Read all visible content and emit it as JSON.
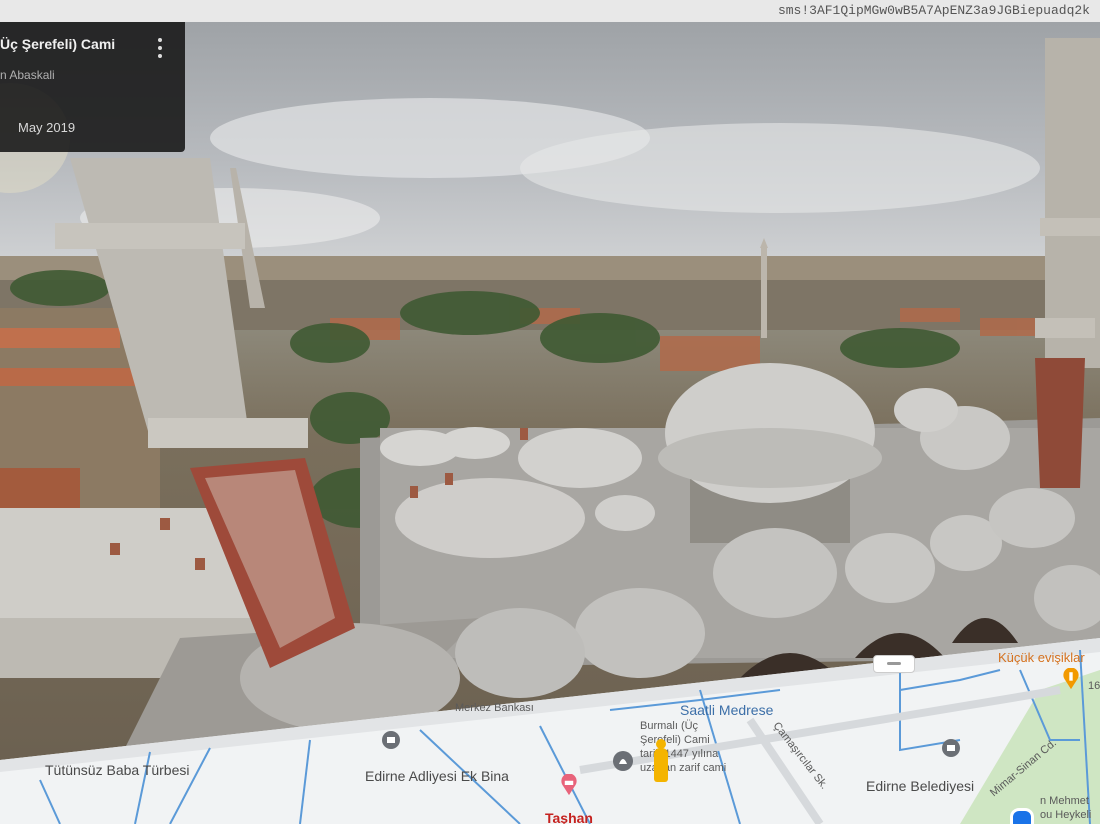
{
  "browser": {
    "url_fragment": "sms!3AF1QipMGw0wB5A7ApENZ3a9JGBiepuadq2k"
  },
  "street_view": {
    "place_title": "Üç Şerefeli) Cami",
    "author": "n Abaskali",
    "date": "May 2019"
  },
  "map": {
    "labels": {
      "merkez": "Merkez Bankası",
      "saatli": "Saatli Medrese",
      "burmali_line1": "Burmalı (Üç",
      "burmali_line2": "Şerefeli) Cami",
      "burmali_line3": "tarih 1447 yılına",
      "burmali_line4": "uzanan zarif cami",
      "tutunsuz": "Tütünsüz Baba Türbesi",
      "adliye": "Edirne Adliyesi Ek Bina",
      "belediye": "Edirne Belediyesi",
      "kucuk": "Küçük evişiklar",
      "camasircilar": "Çamaşırcılar Sk.",
      "mimar": "Mimar-Sinan Cd.",
      "tashan": "Taşhan",
      "mehmet_line1": "n Mehmet",
      "mehmet_line2": "ou Heykeli",
      "edge_num": "16"
    }
  },
  "icons": {
    "menu": "more-vert-icon",
    "pegman": "pegman-icon",
    "location": "my-location-icon",
    "pins": [
      "museum-pin-icon",
      "mosque-pin-icon",
      "hotel-pin-icon",
      "food-pin-icon"
    ]
  },
  "colors": {
    "map_bg": "#f1f3f4",
    "map_road": "#4a90d9",
    "card_bg": "#161616",
    "pegman": "#f4b400",
    "hotel_pin": "#e8637a",
    "food_pin": "#f29900"
  }
}
